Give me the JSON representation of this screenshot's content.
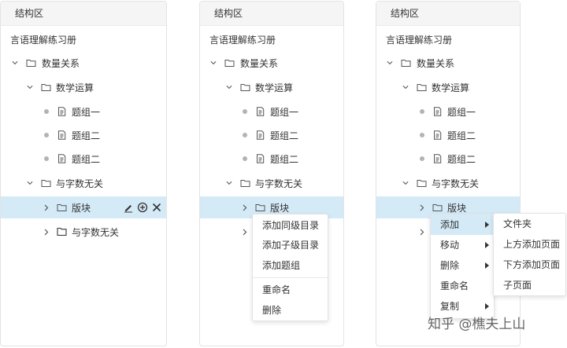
{
  "panel_title": "结构区",
  "root_label": "言语理解练习册",
  "tree": {
    "n1": "数量关系",
    "n2": "数学运算",
    "n3": "题组一",
    "n4": "题组二",
    "n5": "题组二",
    "n6": "与字数无关",
    "n7": "版块",
    "n8": "与字数无关"
  },
  "menu_a": {
    "add_sibling": "添加同级目录",
    "add_child": "添加子级目录",
    "add_group": "添加题组",
    "rename": "重命名",
    "delete": "删除"
  },
  "menu_b": {
    "add": "添加",
    "move": "移动",
    "delete": "删除",
    "rename": "重命名",
    "copy": "复制"
  },
  "submenu": {
    "folder": "文件夹",
    "add_above": "上方添加页面",
    "add_below": "下方添加页面",
    "subpage": "子页面"
  },
  "watermark": "知乎 @樵夫上山",
  "colors": {
    "selected_bg": "#d4eaf7",
    "header_bg": "#f5f5f5"
  }
}
